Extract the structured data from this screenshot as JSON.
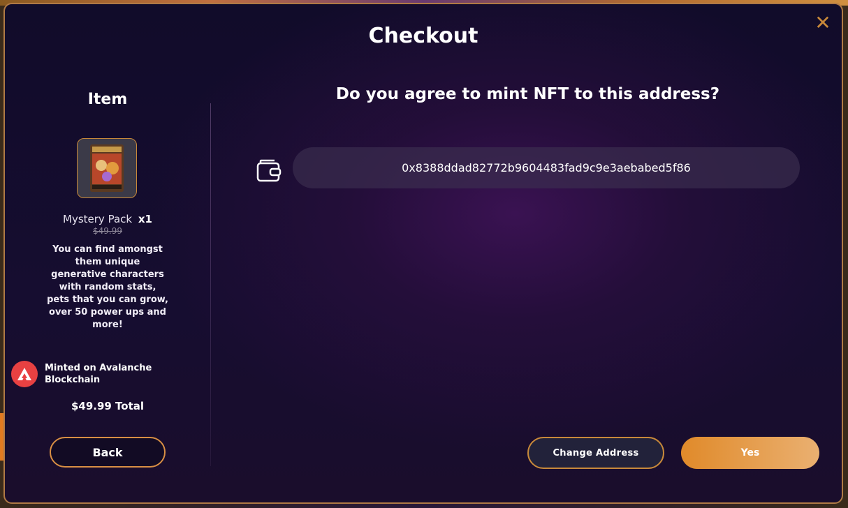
{
  "modal": {
    "title": "Checkout",
    "close_icon": "close-icon"
  },
  "item_panel": {
    "heading": "Item",
    "name": "Mystery Pack",
    "quantity": "x1",
    "price": "$49.99",
    "description": "You can find amongst them unique generative characters with random stats, pets that you can grow, over 50 power ups and more!",
    "chain_text": "Minted on Avalanche Blockchain",
    "chain_icon": "avalanche-icon",
    "total": "$49.99 Total",
    "back_label": "Back"
  },
  "address_panel": {
    "question": "Do you agree to mint NFT to this address?",
    "wallet_icon": "wallet-icon",
    "address": "0x8388ddad82772b9604483fad9c9e3aebabed5f86",
    "change_label": "Change Address",
    "yes_label": "Yes"
  },
  "colors": {
    "accent": "#c8893a",
    "avalanche": "#e84142",
    "yes_start": "#e08a2a",
    "yes_end": "#eab071"
  }
}
